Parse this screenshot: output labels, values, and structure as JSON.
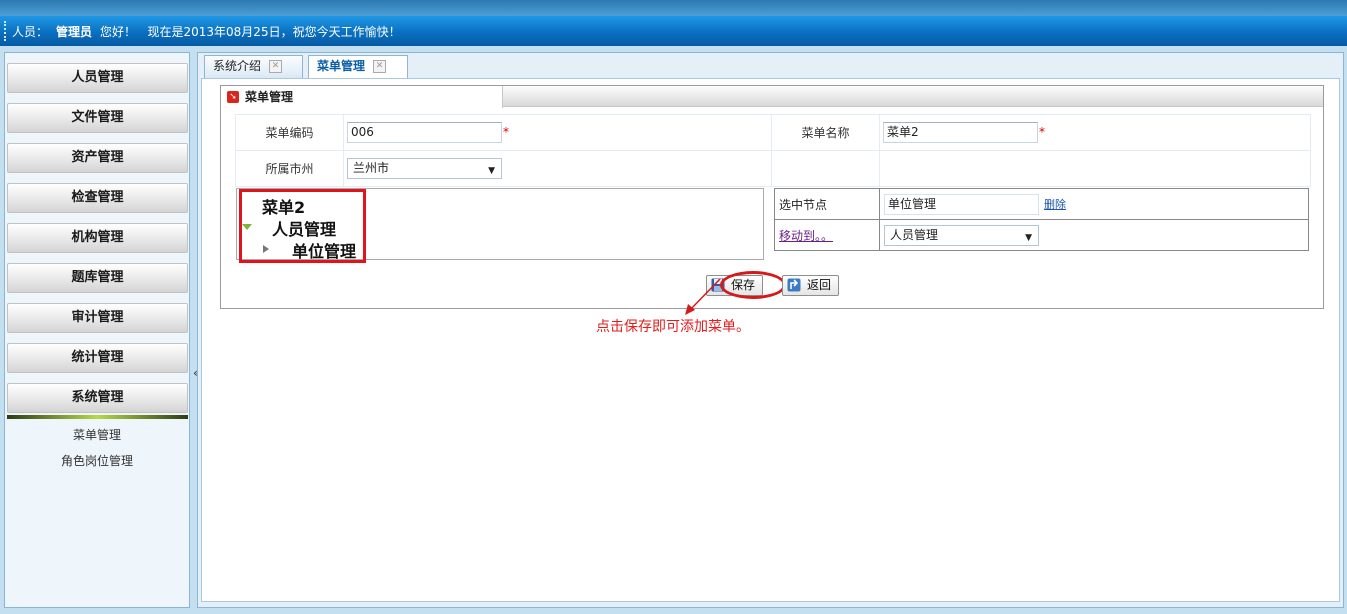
{
  "header": {
    "user_label": "人员：",
    "user_name": "管理员",
    "greeting": "您好！",
    "date_message": "现在是2013年08月25日，祝您今天工作愉快！"
  },
  "sidebar": {
    "items": [
      {
        "label": "人员管理"
      },
      {
        "label": "文件管理"
      },
      {
        "label": "资产管理"
      },
      {
        "label": "检查管理"
      },
      {
        "label": "机构管理"
      },
      {
        "label": "题库管理"
      },
      {
        "label": "审计管理"
      },
      {
        "label": "统计管理"
      },
      {
        "label": "系统管理"
      }
    ],
    "submenu": [
      {
        "label": "菜单管理"
      },
      {
        "label": "角色岗位管理"
      }
    ],
    "collapse_icon": "«"
  },
  "tabs": [
    {
      "label": "系统介绍"
    },
    {
      "label": "菜单管理"
    }
  ],
  "form": {
    "title": "菜单管理",
    "menu_code_label": "菜单编码",
    "menu_code_value": "006",
    "menu_name_label": "菜单名称",
    "menu_name_value": "菜单2",
    "city_label": "所属市州",
    "city_value": "兰州市",
    "required_mark": "*"
  },
  "tree": {
    "nodes": [
      {
        "label": "菜单2"
      },
      {
        "label": "人员管理"
      },
      {
        "label": "单位管理"
      }
    ]
  },
  "node_panel": {
    "selected_label": "选中节点",
    "selected_value": "单位管理",
    "delete_link": "删除",
    "move_link": "移动到。。",
    "move_value": "人员管理"
  },
  "buttons": {
    "save": "保存",
    "back": "返回"
  },
  "annotation": {
    "note": "点击保存即可添加菜单。"
  },
  "colors": {
    "header_blue": "#0b6fc0",
    "highlight_red": "#e0141a",
    "active_tab": "#0d5fa6"
  }
}
